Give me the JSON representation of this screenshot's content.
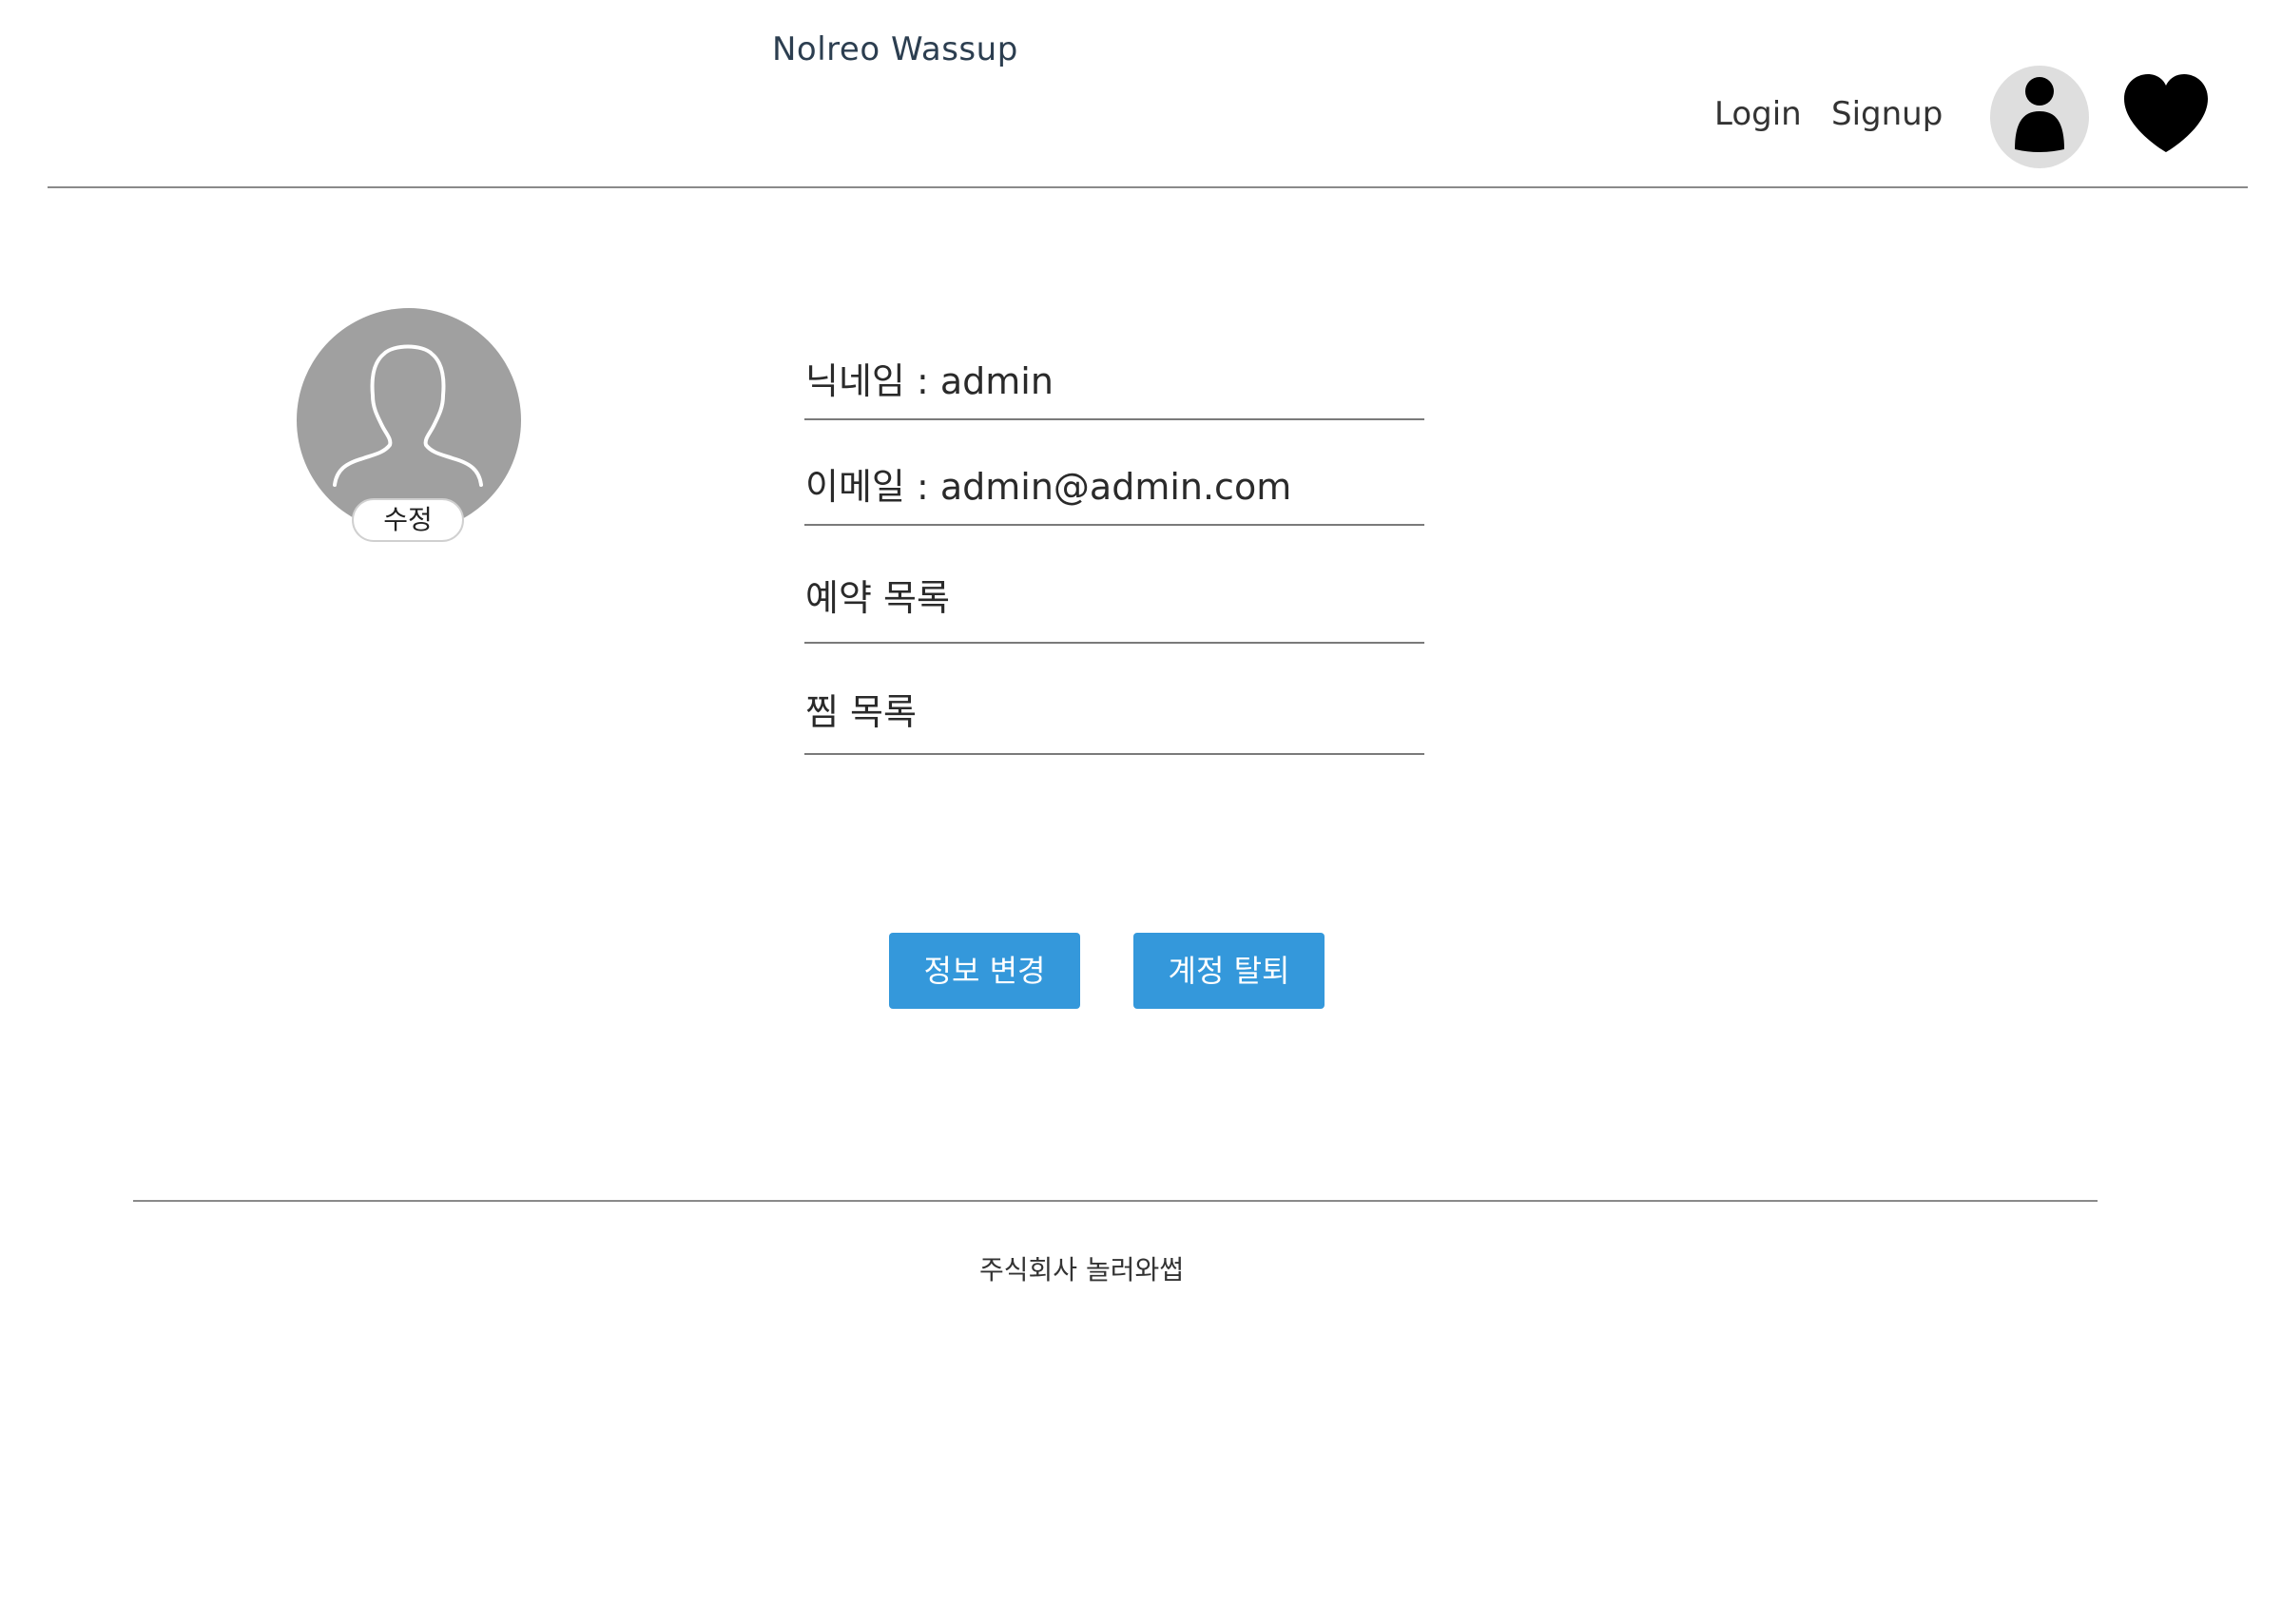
{
  "header": {
    "brand": "Nolreo Wassup",
    "nav": {
      "login": "Login",
      "signup": "Signup"
    },
    "icons": {
      "user": "user-icon",
      "wishlist": "heart-icon"
    }
  },
  "profile": {
    "avatar_icon": "user-silhouette-icon",
    "edit_label": "수정"
  },
  "info": {
    "nickname": "닉네임 : admin",
    "email": "이메일 : admin@admin.com",
    "reservations": "예약 목록",
    "wishlist": "찜 목록"
  },
  "actions": {
    "edit_info": "정보 변경",
    "delete_account": "계정 탈퇴"
  },
  "footer": {
    "company": "주식회사 놀러와썹"
  },
  "colors": {
    "accent": "#3498db",
    "avatar_bg": "#a0a0a0",
    "user_btn_bg": "#dedede"
  }
}
